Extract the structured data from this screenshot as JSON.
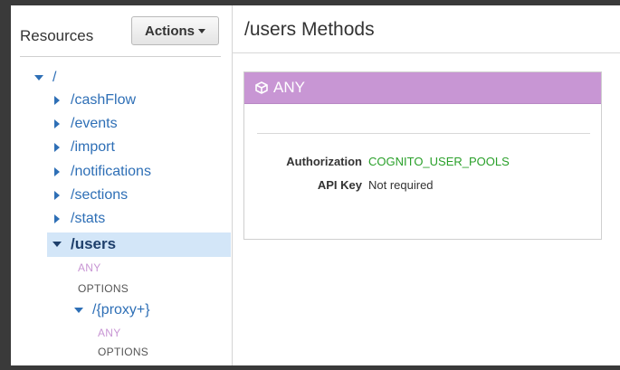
{
  "left_panel": {
    "title": "Resources",
    "actions_label": "Actions"
  },
  "tree": {
    "root": "/",
    "children": [
      {
        "label": "/cashFlow"
      },
      {
        "label": "/events"
      },
      {
        "label": "/import"
      },
      {
        "label": "/notifications"
      },
      {
        "label": "/sections"
      },
      {
        "label": "/stats"
      }
    ],
    "users": {
      "label": "/users",
      "methods": [
        "ANY",
        "OPTIONS"
      ],
      "proxy": {
        "label": "/{proxy+}",
        "methods": [
          "ANY",
          "OPTIONS"
        ]
      }
    }
  },
  "main": {
    "title": "/users Methods",
    "method_card": {
      "method": "ANY",
      "rows": [
        {
          "label": "Authorization",
          "value": "COGNITO_USER_POOLS"
        },
        {
          "label": "API Key",
          "value": "Not required"
        }
      ]
    }
  },
  "colors": {
    "link": "#2e6fb6",
    "any_method": "#c896d4",
    "options_method": "#555555",
    "authorization_value": "#2aa02a",
    "selected_row": "#d3e6f8"
  },
  "icons": {
    "method_card_icon": "cube-icon"
  }
}
